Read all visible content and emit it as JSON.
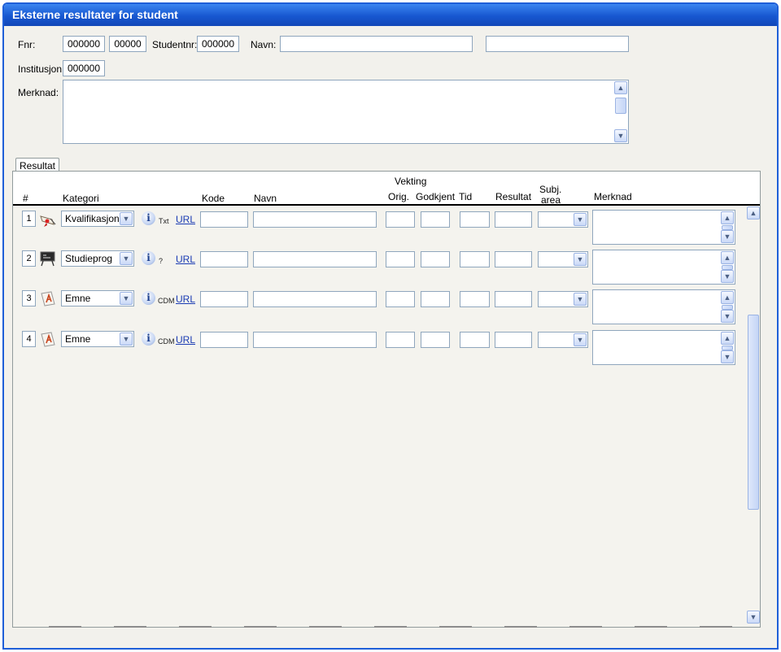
{
  "window": {
    "title": "Eksterne resultater for student"
  },
  "form": {
    "fnr_label": "Fnr:",
    "fnr_value": "000000",
    "fnr_value2": "00000",
    "studentnr_label": "Studentnr:",
    "studentnr_value": "000000",
    "navn_label": "Navn:",
    "navn_value1": "",
    "navn_value2": "",
    "institusjon_label": "Institusjon:",
    "institusjon_value": "000000",
    "merknad_label": "Merknad:",
    "merknad_value": ""
  },
  "tab": {
    "label": "Resultat"
  },
  "table": {
    "headers": {
      "nr": "#",
      "kategori": "Kategori",
      "kode": "Kode",
      "navn": "Navn",
      "vekting": "Vekting",
      "orig": "Orig.",
      "godkjent": "Godkjent",
      "tid": "Tid",
      "resultat": "Resultat",
      "subj1": "Subj.",
      "subj2": "area",
      "merknad": "Merknad"
    },
    "rows": [
      {
        "nr": "1",
        "icon": "diploma-icon",
        "kategori": "Kvalifikasjon",
        "tag": "Txt",
        "url": "URL"
      },
      {
        "nr": "2",
        "icon": "blackboard-icon",
        "kategori": "Studieprog",
        "tag": "?",
        "url": "URL"
      },
      {
        "nr": "3",
        "icon": "course-book-icon",
        "kategori": "Emne",
        "tag": "CDM",
        "url": "URL"
      },
      {
        "nr": "4",
        "icon": "course-book-icon",
        "kategori": "Emne",
        "tag": "CDM",
        "url": "URL"
      }
    ]
  },
  "colors": {
    "titlebar": "#1757d0",
    "field_border": "#8fa6bd",
    "link": "#1a3bb3"
  }
}
